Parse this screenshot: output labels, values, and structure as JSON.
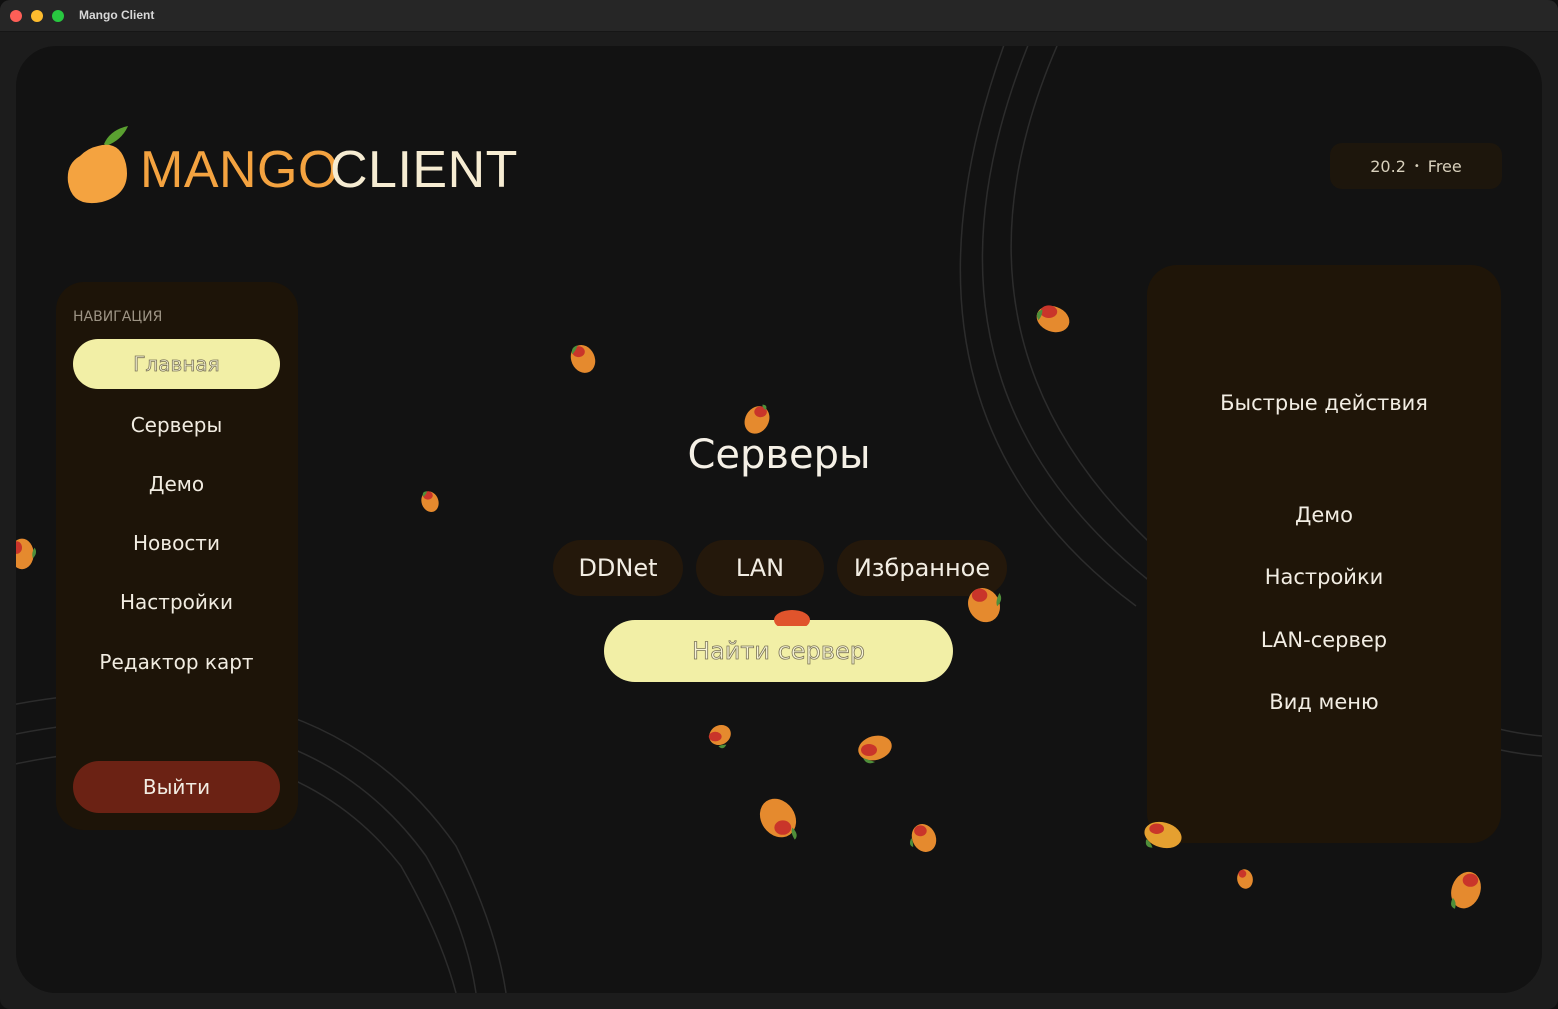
{
  "window": {
    "title": "Mango Client"
  },
  "brand": {
    "part1": "MANGO",
    "part2": "CLIENT",
    "logo_icon": "mango-logo-icon"
  },
  "version": {
    "number": "20.2",
    "separator": "•",
    "tier": "Free"
  },
  "nav": {
    "heading": "НАВИГАЦИЯ",
    "items": [
      {
        "label": "Главная",
        "active": true
      },
      {
        "label": "Серверы",
        "active": false
      },
      {
        "label": "Демо",
        "active": false
      },
      {
        "label": "Новости",
        "active": false
      },
      {
        "label": "Настройки",
        "active": false
      },
      {
        "label": "Редактор карт",
        "active": false
      }
    ],
    "logout": "Выйти"
  },
  "main": {
    "title": "Серверы",
    "tabs": [
      {
        "label": "DDNet"
      },
      {
        "label": "LAN"
      },
      {
        "label": "Избранное"
      }
    ],
    "find_button": "Найти сервер"
  },
  "quick_actions": {
    "title": "Быстрые действия",
    "items": [
      {
        "label": "Демо"
      },
      {
        "label": "Настройки"
      },
      {
        "label": "LAN-сервер"
      },
      {
        "label": "Вид меню"
      }
    ]
  },
  "colors": {
    "accent_orange": "#f4a340",
    "accent_yellow": "#f2efa6",
    "logout_red": "#6b2214",
    "panel_brown": "#1d1408"
  }
}
